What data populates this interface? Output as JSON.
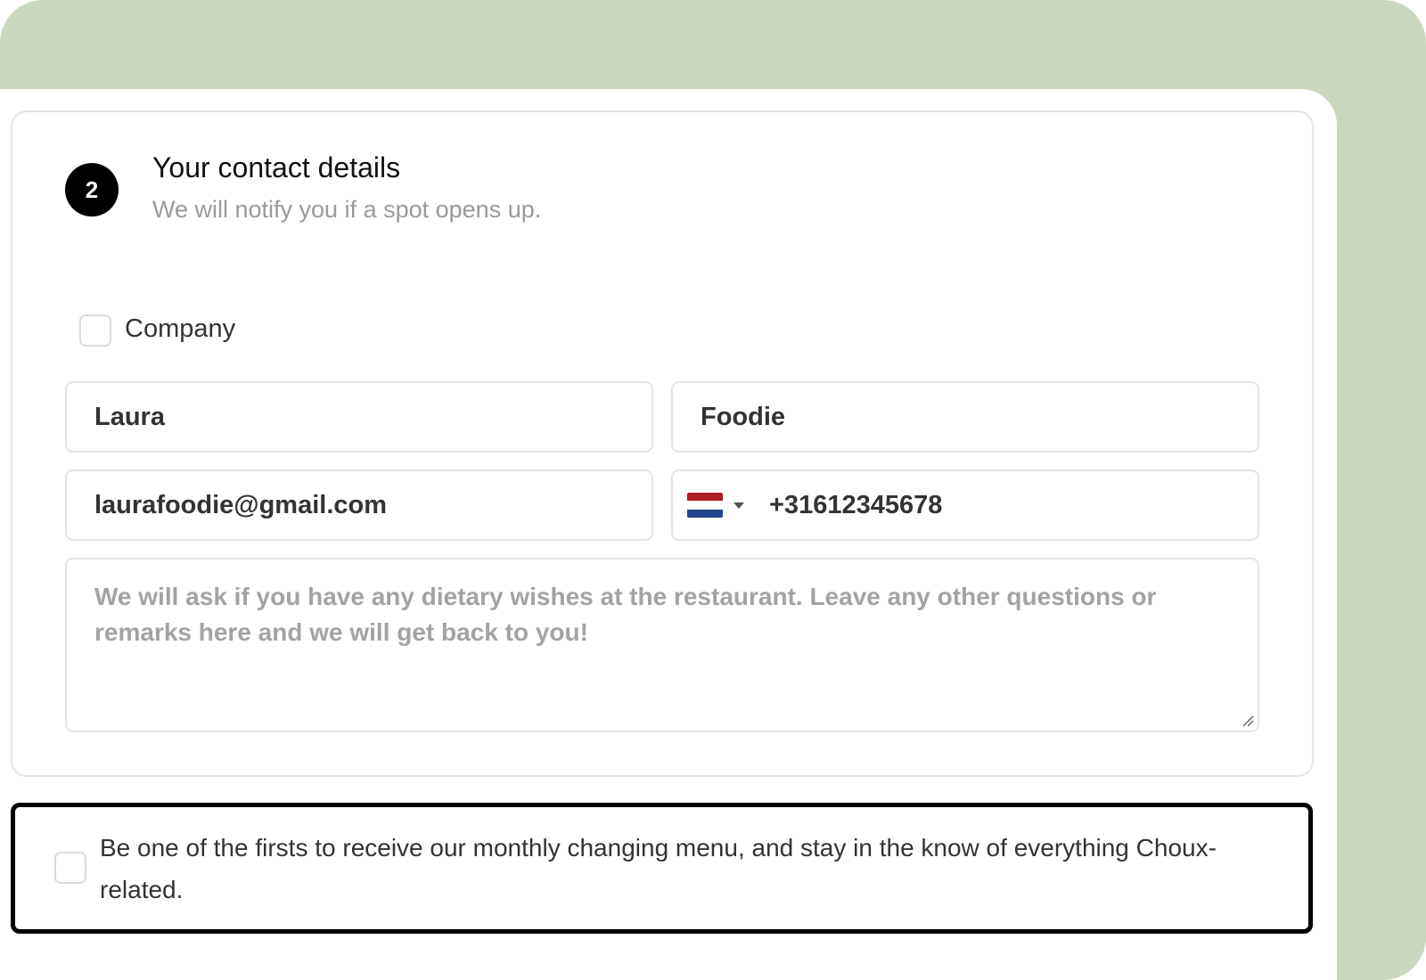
{
  "step": {
    "number": "2",
    "title": "Your contact details",
    "subtitle": "We will notify you if a spot opens up."
  },
  "company": {
    "label": "Company",
    "checked": false
  },
  "form": {
    "first_name": "Laura",
    "last_name": "Foodie",
    "email": "laurafoodie@gmail.com",
    "phone": {
      "country_flag": "netherlands-flag",
      "flag_colors": [
        "#ae1c28",
        "#ffffff",
        "#21468b"
      ],
      "number": "+31612345678"
    },
    "remarks_placeholder": "We will ask if you have any dietary wishes at the restaurant. Leave any other questions or remarks here and we will get back to you!"
  },
  "newsletter": {
    "checked": false,
    "text": "Be one of the firsts to receive our monthly changing menu, and stay in the know of everything Choux-related."
  },
  "colors": {
    "backdrop": "#cbd8c0",
    "accent": "#000000",
    "placeholder": "#a3a3a3"
  }
}
